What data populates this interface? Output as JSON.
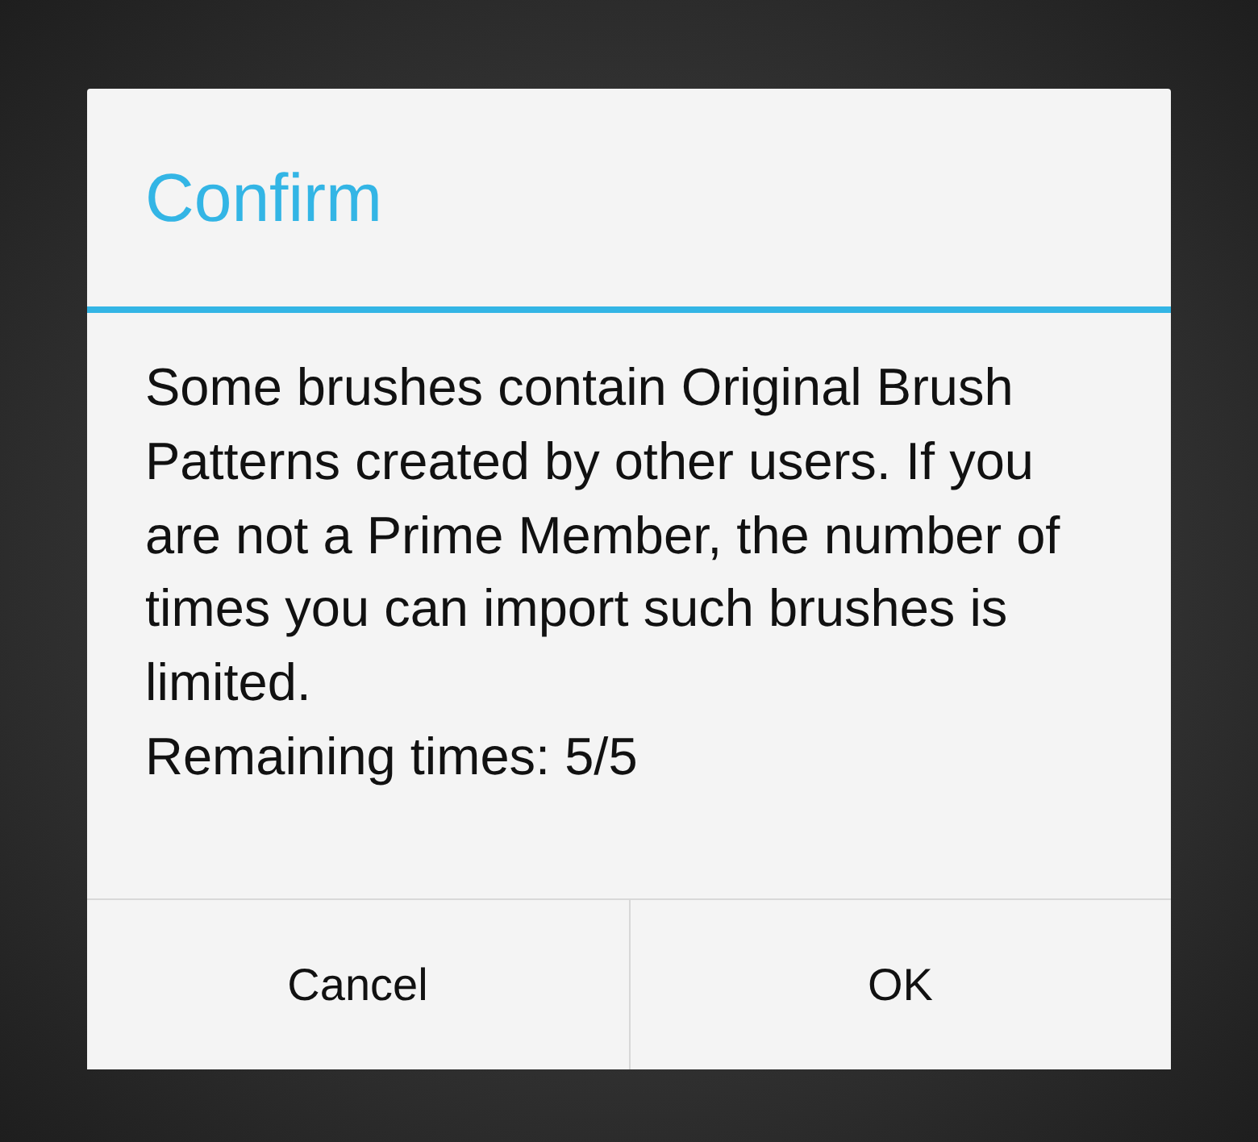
{
  "dialog": {
    "title": "Confirm",
    "message": "Some brushes contain Original Brush Patterns created by other users. If you are not a Prime Member, the number of times you can import such brushes is limited.",
    "remaining": "Remaining times: 5/5",
    "buttons": [
      {
        "label": "Cancel"
      },
      {
        "label": "OK"
      }
    ]
  }
}
